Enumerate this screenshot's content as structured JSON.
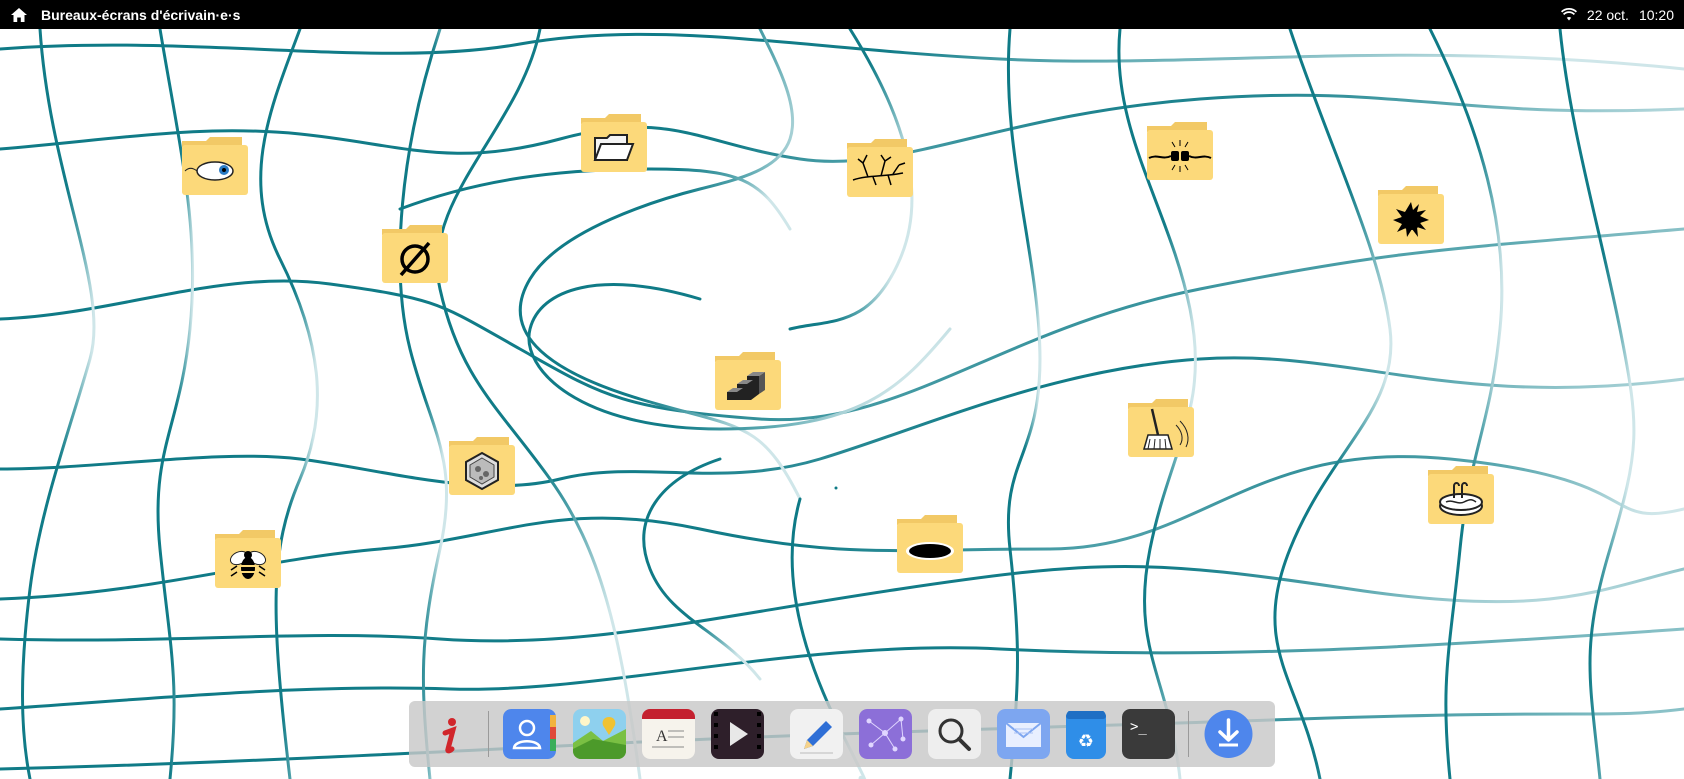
{
  "topbar": {
    "workspace_title": "Bureaux-écrans d'écrivain·e·s",
    "date": "22 oct.",
    "time": "10:20",
    "home_icon": "home-icon",
    "network_icon": "wifi-icon",
    "background": "#000000"
  },
  "desktop": {
    "wallpaper": "teal-distorted-grid",
    "wallpaper_color": "#0e7a86",
    "folder_color": "#fcd97a",
    "folders": [
      {
        "id": "eye",
        "icon": "eye-icon"
      },
      {
        "id": "empty-set",
        "icon": "empty-set-icon"
      },
      {
        "id": "open-folder",
        "icon": "open-folder-icon"
      },
      {
        "id": "branches",
        "icon": "branches-icon"
      },
      {
        "id": "plug",
        "icon": "electric-plug-icon"
      },
      {
        "id": "splat",
        "icon": "ink-splat-icon"
      },
      {
        "id": "stairs",
        "icon": "stairs-icon"
      },
      {
        "id": "hexagon",
        "icon": "hexagon-icon"
      },
      {
        "id": "broom",
        "icon": "broom-icon"
      },
      {
        "id": "hole",
        "icon": "hole-icon"
      },
      {
        "id": "pool",
        "icon": "pool-icon"
      },
      {
        "id": "bee",
        "icon": "bee-icon"
      }
    ]
  },
  "dock": {
    "items": [
      {
        "id": "info",
        "icon": "info-icon"
      },
      {
        "id": "contacts",
        "icon": "contacts-icon"
      },
      {
        "id": "maps",
        "icon": "maps-icon"
      },
      {
        "id": "dictionary",
        "icon": "dictionary-icon"
      },
      {
        "id": "video",
        "icon": "video-player-icon"
      },
      {
        "id": "text-editor",
        "icon": "pen-editor-icon"
      },
      {
        "id": "network",
        "icon": "network-graph-icon"
      },
      {
        "id": "search",
        "icon": "magnifier-icon"
      },
      {
        "id": "mail",
        "icon": "mail-icon"
      },
      {
        "id": "recycle",
        "icon": "recycle-bin-icon"
      },
      {
        "id": "terminal",
        "icon": "terminal-icon"
      },
      {
        "id": "downloads",
        "icon": "download-icon"
      }
    ],
    "accent": "#4e86ec",
    "terminal_prompt": ">_"
  }
}
